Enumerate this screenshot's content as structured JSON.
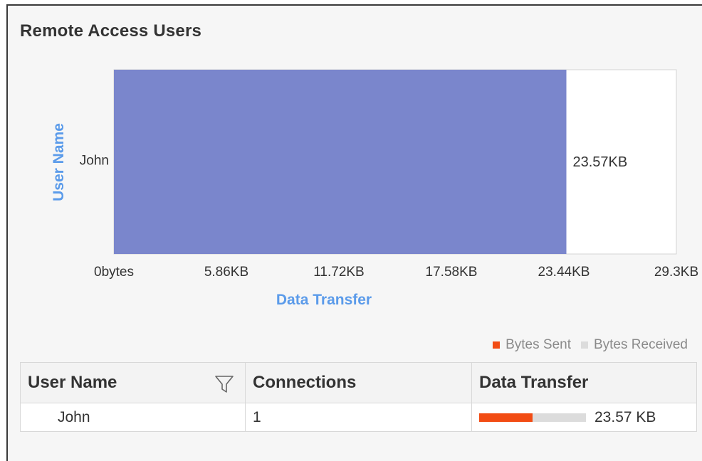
{
  "widget": {
    "title": "Remote Access Users"
  },
  "chart_data": {
    "type": "bar",
    "orientation": "horizontal",
    "categories": [
      "John"
    ],
    "values": [
      23.57
    ],
    "value_labels": [
      "23.57KB"
    ],
    "xlabel": "Data Transfer",
    "ylabel": "User Name",
    "xlim": [
      0,
      29.3
    ],
    "x_unit": "KB",
    "x_ticks": [
      0,
      5.86,
      11.72,
      17.58,
      23.44,
      29.3
    ],
    "x_tick_labels": [
      "0bytes",
      "5.86KB",
      "11.72KB",
      "17.58KB",
      "23.44KB",
      "29.3KB"
    ],
    "grid": true,
    "colors": {
      "bar": "#7a86cc",
      "axis_label": "#5b9bea",
      "grid": "#7a7a7a"
    }
  },
  "legend": {
    "items": [
      {
        "label": "Bytes Sent",
        "color": "#f24c14"
      },
      {
        "label": "Bytes Received",
        "color": "#dcdcdc"
      }
    ]
  },
  "table": {
    "headers": {
      "user_name": "User Name",
      "connections": "Connections",
      "data_transfer": "Data Transfer"
    },
    "filter_icon": "filter-funnel-icon",
    "rows": [
      {
        "user_name": "John",
        "connections": "1",
        "data_transfer": "23.57 KB",
        "sent_fraction": 0.5,
        "sent_color": "#f24c14"
      }
    ]
  }
}
